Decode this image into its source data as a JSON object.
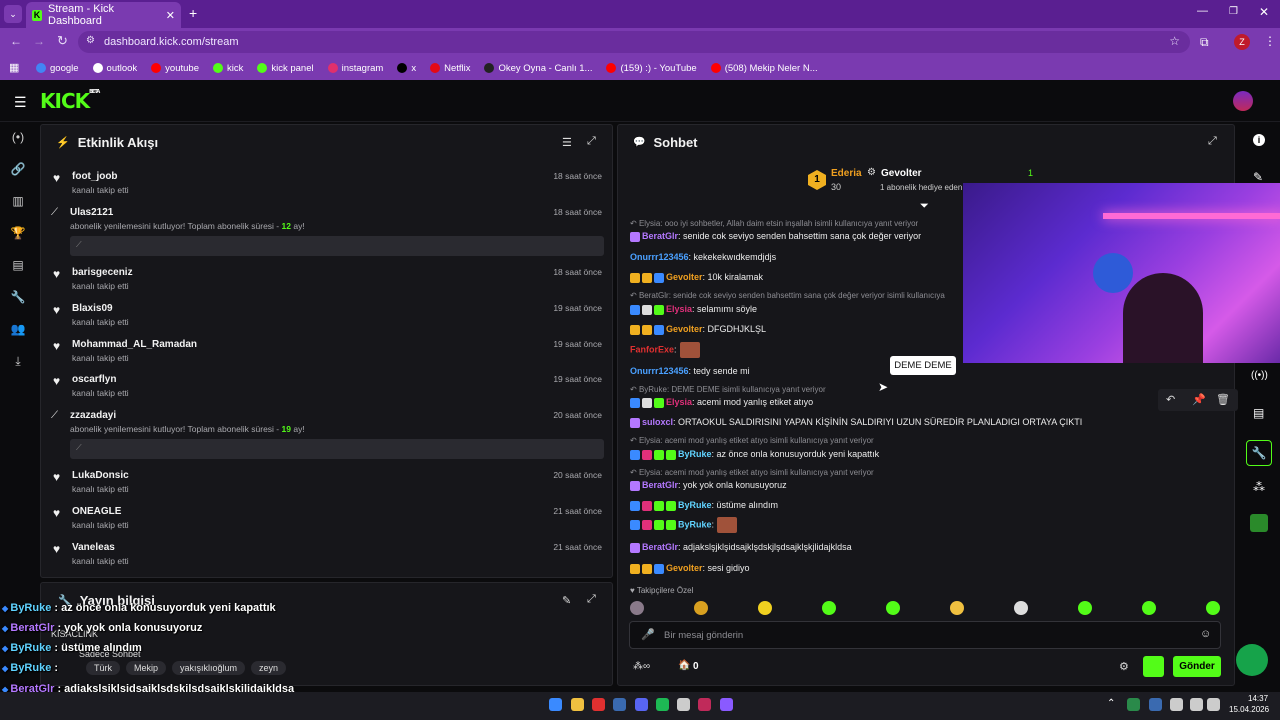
{
  "browser": {
    "tab_title": "Stream - Kick Dashboard",
    "url": "dashboard.kick.com/stream",
    "profile_initial": "Z",
    "bookmarks": [
      {
        "label": "google",
        "color": "#4285f4"
      },
      {
        "label": "outlook",
        "color": "#ffffff"
      },
      {
        "label": "youtube",
        "color": "#ff0000"
      },
      {
        "label": "kick",
        "color": "#53fc18"
      },
      {
        "label": "kick panel",
        "color": "#53fc18"
      },
      {
        "label": "instagram",
        "color": "#e1306c"
      },
      {
        "label": "x",
        "color": "#000000"
      },
      {
        "label": "Netflix",
        "color": "#e50914"
      },
      {
        "label": "Okey Oyna - Canlı 1...",
        "color": "#222222"
      },
      {
        "label": "(159) :) - YouTube",
        "color": "#ff0000"
      },
      {
        "label": "(508) Mekip Neler N...",
        "color": "#ff0000"
      }
    ]
  },
  "kick": {
    "logo": "KICK",
    "beta": "BETA"
  },
  "activity": {
    "title": "Etkinlik Akışı",
    "rows": [
      {
        "name": "foot_joob",
        "sub": "kanalı takip etti",
        "time": "18 saat önce",
        "type": "follow"
      },
      {
        "name": "Ulas2121",
        "sub_pre": "abonelik yenilemesini kutluyor! Toplam abonelik süresi - ",
        "months": "12",
        "sub_post": " ay!",
        "time": "18 saat önce",
        "type": "sub"
      },
      {
        "name": "barisgeceniz",
        "sub": "kanalı takip etti",
        "time": "18 saat önce",
        "type": "follow"
      },
      {
        "name": "Blaxis09",
        "sub": "kanalı takip etti",
        "time": "19 saat önce",
        "type": "follow"
      },
      {
        "name": "Mohammad_AL_Ramadan",
        "sub": "kanalı takip etti",
        "time": "19 saat önce",
        "type": "follow"
      },
      {
        "name": "oscarflyn",
        "sub": "kanalı takip etti",
        "time": "19 saat önce",
        "type": "follow"
      },
      {
        "name": "zzazadayi",
        "sub_pre": "abonelik yenilemesini kutluyor! Toplam abonelik süresi - ",
        "months": "19",
        "sub_post": " ay!",
        "time": "20 saat önce",
        "type": "sub"
      },
      {
        "name": "LukaDonsic",
        "sub": "kanalı takip etti",
        "time": "20 saat önce",
        "type": "follow"
      },
      {
        "name": "ONEAGLE",
        "sub": "kanalı takip etti",
        "time": "21 saat önce",
        "type": "follow"
      },
      {
        "name": "Vaneleas",
        "sub": "kanalı takip etti",
        "time": "21 saat önce",
        "type": "follow"
      }
    ]
  },
  "yayin": {
    "title": "Yayın bilgisi",
    "kisa": "KISACLINK",
    "sadece": "Sadece Sohbet",
    "tags": [
      "Türk",
      "Mekip",
      "yakışıklıoğlum",
      "zeyn"
    ]
  },
  "chat": {
    "title": "Sohbet",
    "pinned": {
      "user1": "Ederia",
      "count1": "30",
      "rank": "1",
      "user2": "Gevolter",
      "count2": "1",
      "gift": "1 abonelik hediye eden"
    },
    "tooltip": "DEME DEME",
    "lines": [
      {
        "kind": "reply",
        "text": "Elysia: ooo iyi sohbetler, Allah daim etsin inşallah      isimli kullanıcıya yanıt veriyor"
      },
      {
        "kind": "msg",
        "user": "BeratGlr",
        "ucls": "u-purple",
        "text": ": senide cok seviyo senden bahsettim sana çok değer veriyor"
      },
      {
        "kind": "msg",
        "user": "Onurrr123456",
        "ucls": "u-blue",
        "text": ": kekekekwıdkemdjdjs"
      },
      {
        "kind": "msg",
        "user": "Gevolter",
        "ucls": "u-orange",
        "text": ": 10k kiralamak"
      },
      {
        "kind": "reply",
        "text": "BeratGlr: senide cok seviyo senden bahsettim sana çok değer veriyor isimli kullanıcıya"
      },
      {
        "kind": "msg",
        "user": "Elysia",
        "ucls": "u-pink",
        "text": ": selamımı söyle"
      },
      {
        "kind": "msg",
        "user": "Gevolter",
        "ucls": "u-orange",
        "text": ": DFGDHJKLŞL"
      },
      {
        "kind": "msg",
        "user": "FanforExe",
        "ucls": "u-red",
        "text": ":"
      },
      {
        "kind": "msg",
        "user": "Onurrr123456",
        "ucls": "u-blue",
        "text": ": tedy sende mi"
      },
      {
        "kind": "reply",
        "text": "ByRuke: DEME DEME isimli kullanıcıya yanıt veriyor"
      },
      {
        "kind": "msg",
        "user": "Elysia",
        "ucls": "u-pink",
        "text": ": acemi mod yanlış etiket atıyo"
      },
      {
        "kind": "msg",
        "user": "suloxcl",
        "ucls": "u-purple",
        "text": ": ORTAOKUL SALDIRISINI YAPAN KİŞİNİN SALDIRIYI UZUN SÜREDİR PLANLADIGI ORTAYA ÇIKTI"
      },
      {
        "kind": "reply",
        "text": "Elysia: acemi mod yanlış etiket atıyo isimli kullanıcıya yanıt veriyor"
      },
      {
        "kind": "msg",
        "user": "ByRuke",
        "ucls": "u-green",
        "text": ": az önce onla konusuyorduk yeni kapattık"
      },
      {
        "kind": "reply",
        "text": "Elysia: acemi mod yanlış etiket atıyo isimli kullanıcıya yanıt veriyor"
      },
      {
        "kind": "msg",
        "user": "BeratGlr",
        "ucls": "u-purple",
        "text": ": yok yok onla konusuyoruz"
      },
      {
        "kind": "msg",
        "user": "ByRuke",
        "ucls": "u-green",
        "text": ": üstüme alındım"
      },
      {
        "kind": "msg",
        "user": "ByRuke",
        "ucls": "u-green",
        "text": ":"
      },
      {
        "kind": "msg",
        "user": "BeratGlr",
        "ucls": "u-purple",
        "text": ": adjakslşjklşidsajklşdskjlşdsajklşkjlidajkldsa"
      },
      {
        "kind": "msg",
        "user": "Gevolter",
        "ucls": "u-orange",
        "text": ": sesi gidiyo"
      }
    ],
    "followers_label": "Takipçilere Özel",
    "input_placeholder": "Bir mesaj gönderin",
    "footer_count": "0",
    "send_label": "Gönder"
  },
  "overlay": [
    {
      "user": "ByRuke",
      "text": " : az önce onla konusuyorduk yeni kapattık",
      "color": "#60d3ff"
    },
    {
      "user": "BeratGlr",
      "text": " : yok yok onla konusuyoruz",
      "color": "#b478ff"
    },
    {
      "user": "ByRuke",
      "text": " : üstüme alındım",
      "color": "#60d3ff"
    },
    {
      "user": "ByRuke",
      "text": " :",
      "color": "#60d3ff"
    },
    {
      "user": "BeratGlr",
      "text": " : adjakslşjklşidsajklşdskjlşdsajklşkjlidajkldsa",
      "color": "#b478ff"
    },
    {
      "user": "Gevolter",
      "text": " : sesi gidiyo",
      "color": "#f0a020"
    }
  ],
  "taskbar": {
    "time": "14:37",
    "date": "15.04.2026"
  }
}
